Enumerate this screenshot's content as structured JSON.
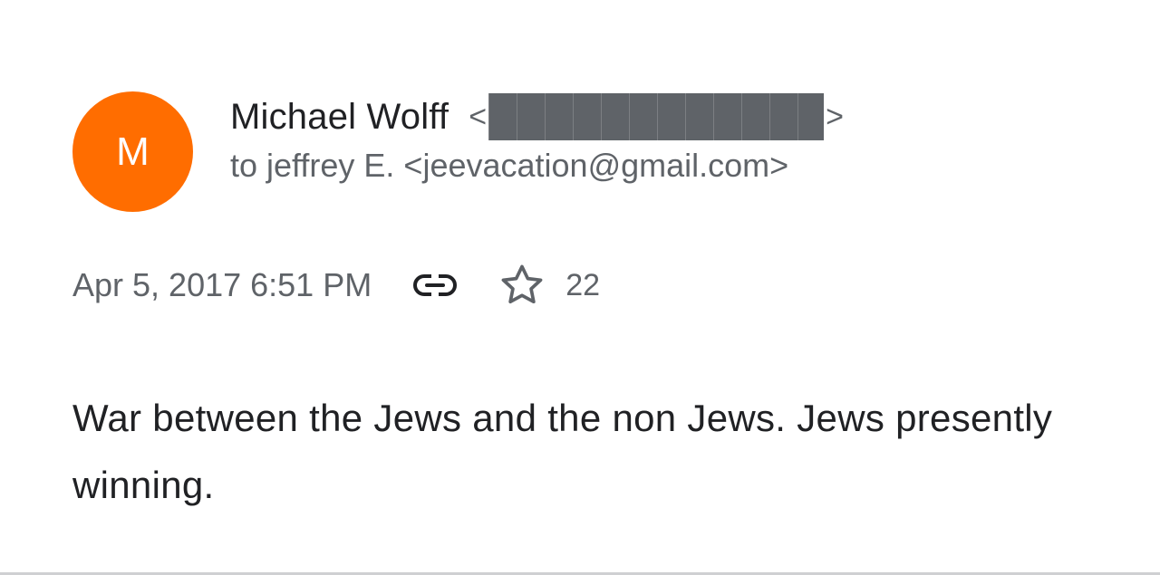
{
  "sender": {
    "avatar_initial": "M",
    "avatar_color": "#ff6d00",
    "name": "Michael Wolff",
    "email_open": "<",
    "email_close": ">",
    "email_redacted": true
  },
  "recipient": {
    "prefix": "to",
    "text": "jeffrey E. <jeevacation@gmail.com>"
  },
  "meta": {
    "timestamp": "Apr 5, 2017 6:51 PM",
    "link_icon": "link-icon",
    "star_icon": "star-outline-icon",
    "star_count": "22"
  },
  "message": {
    "body": "War between the Jews and the non Jews. Jews presently winning."
  },
  "colors": {
    "primary_text": "#202124",
    "secondary_text": "#5f6368",
    "redaction": "#5f6368"
  }
}
